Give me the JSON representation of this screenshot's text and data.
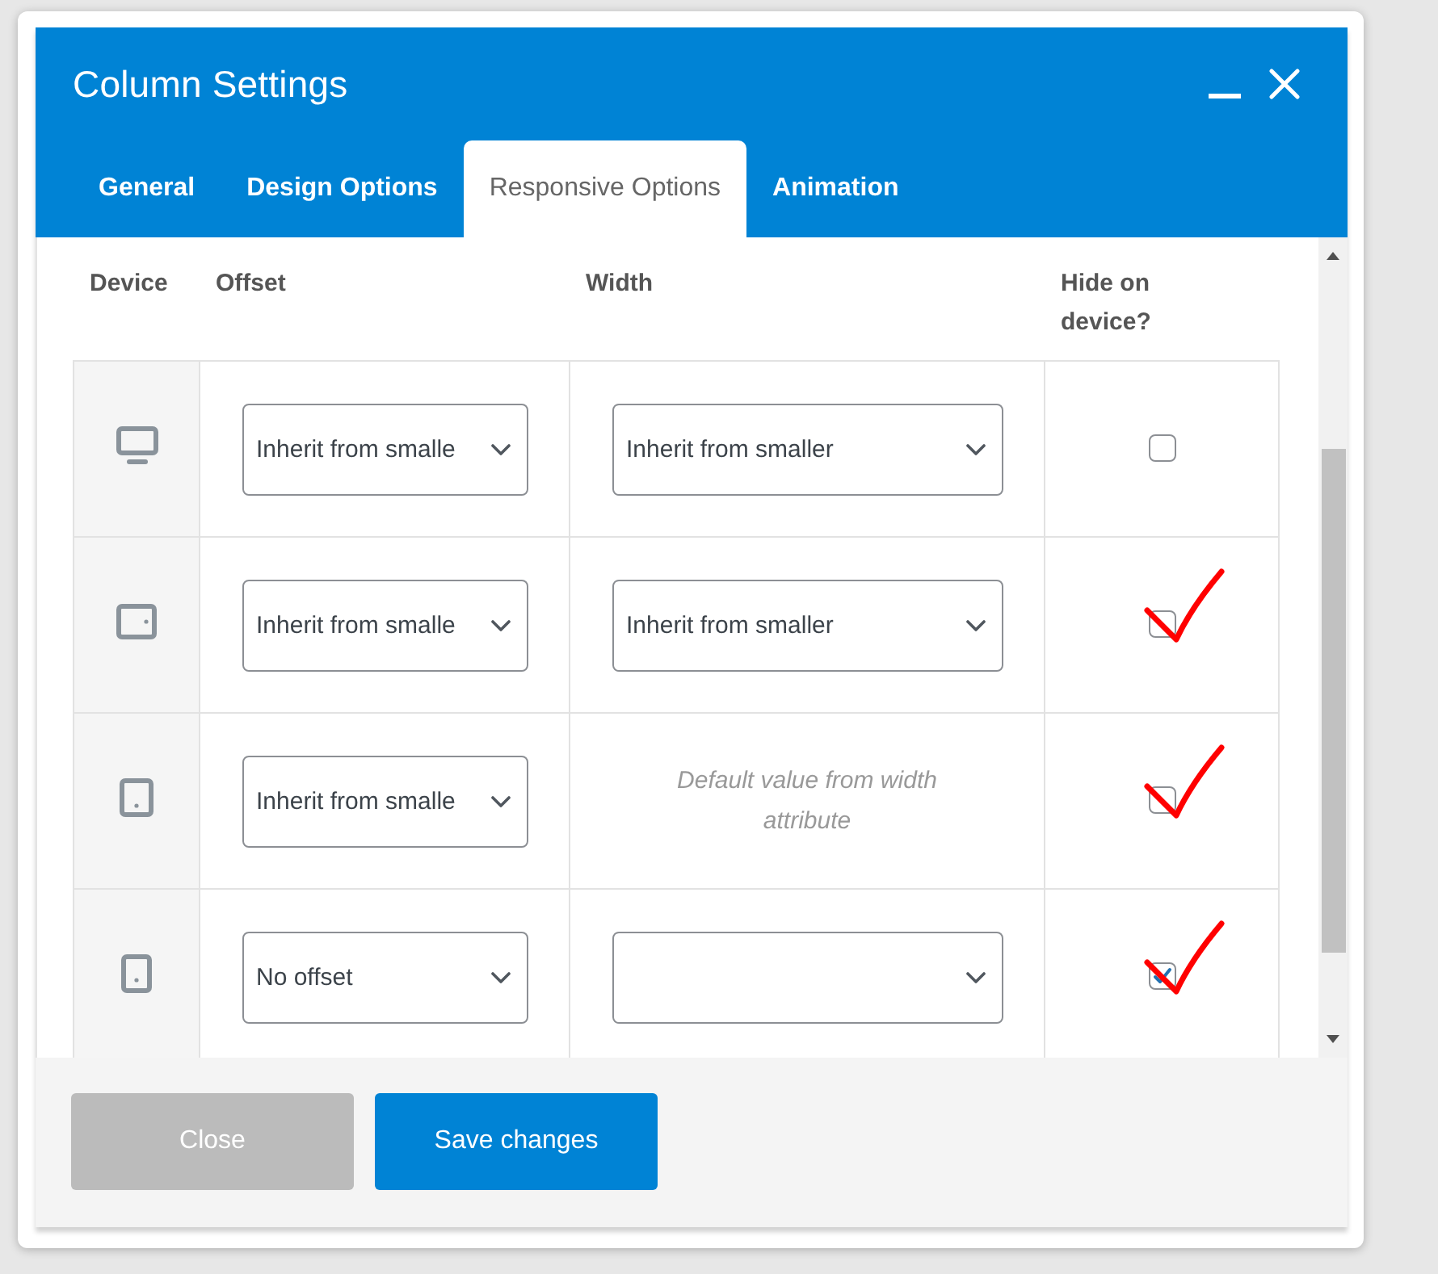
{
  "dialog": {
    "title": "Column Settings"
  },
  "tabs": [
    {
      "label": "General",
      "selected": false
    },
    {
      "label": "Design Options",
      "selected": false
    },
    {
      "label": "Responsive Options",
      "selected": true
    },
    {
      "label": "Animation",
      "selected": false
    }
  ],
  "table": {
    "columns": [
      "Device",
      "Offset",
      "Width",
      "Hide on device?"
    ],
    "rows": [
      {
        "kind": "desktop",
        "offset": "Inherit from smalle",
        "width": {
          "kind": "select",
          "value": "Inherit from smaller"
        },
        "hide": {
          "checked": false,
          "hand_tick": false
        }
      },
      {
        "kind": "tablet-landscape",
        "offset": "Inherit from smalle",
        "width": {
          "kind": "select",
          "value": "Inherit from smaller"
        },
        "hide": {
          "checked": false,
          "hand_tick": true
        }
      },
      {
        "kind": "tablet-portrait",
        "offset": "Inherit from smalle",
        "width": {
          "kind": "note",
          "text": "Default value from width attribute"
        },
        "hide": {
          "checked": false,
          "hand_tick": true
        }
      },
      {
        "kind": "phone",
        "offset": "No offset",
        "width": {
          "kind": "select"
        },
        "hide": {
          "checked": true,
          "hand_tick": true
        }
      }
    ]
  },
  "buttons": [
    {
      "label": "Close",
      "kind": "secondary"
    },
    {
      "label": "Save changes",
      "kind": "primary"
    }
  ]
}
